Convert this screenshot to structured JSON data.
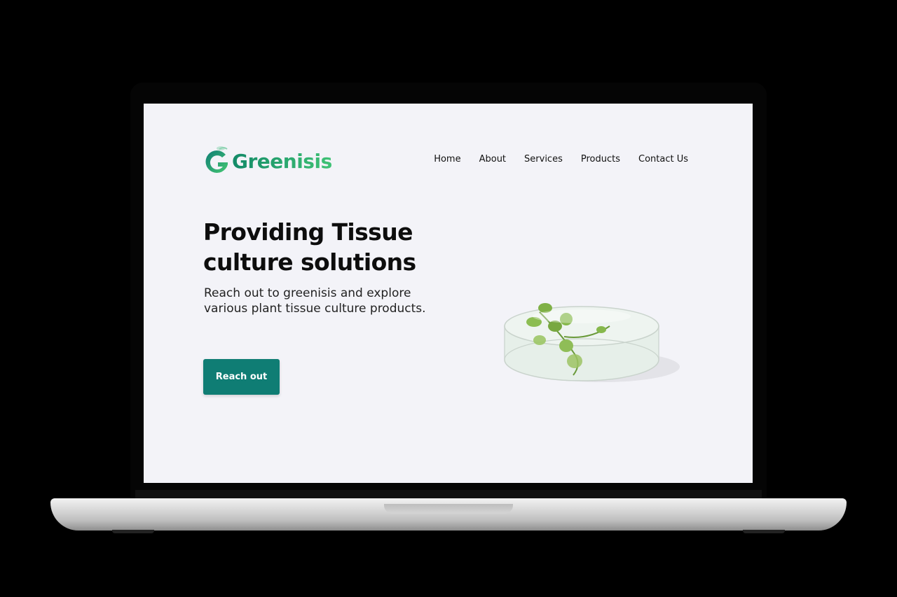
{
  "brand": {
    "name": "Greenisis",
    "color": "#22a66e"
  },
  "nav": {
    "items": [
      {
        "label": "Home"
      },
      {
        "label": "About"
      },
      {
        "label": "Services"
      },
      {
        "label": "Products"
      },
      {
        "label": "Contact Us"
      }
    ]
  },
  "hero": {
    "title": "Providing Tissue culture solutions",
    "subtitle": "Reach out to greenisis and explore various plant tissue culture products.",
    "cta_label": "Reach out",
    "cta_color": "#0f7d74",
    "image_icon": "petri-dish-plant-image"
  },
  "colors": {
    "page_background": "#f3f3f8",
    "device_background": "#000000"
  }
}
